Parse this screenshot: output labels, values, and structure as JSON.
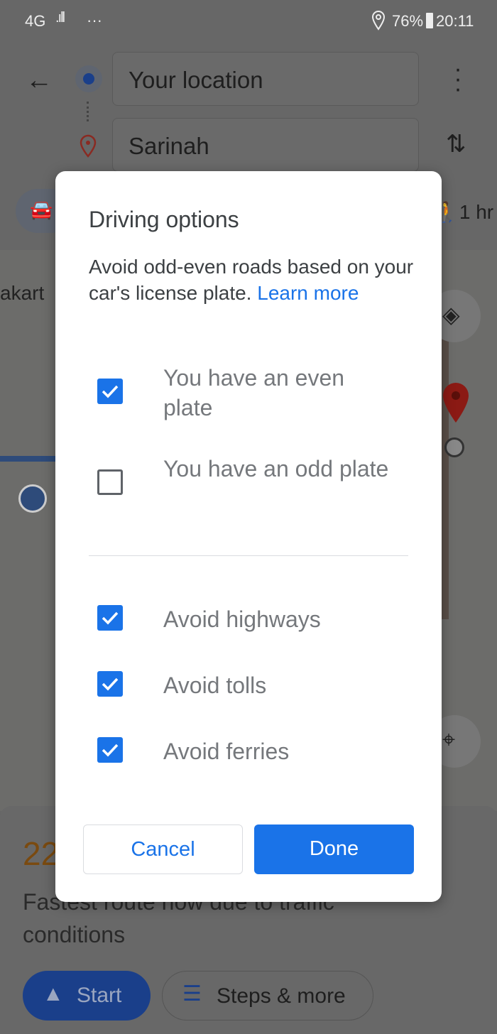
{
  "status_bar": {
    "network": "4G",
    "more": "···",
    "battery": "76%",
    "time": "20:11"
  },
  "header": {
    "origin": "Your location",
    "destination": "Sarinah",
    "walk_time": "1 hr"
  },
  "map": {
    "label": "akart"
  },
  "sheet": {
    "duration": "22",
    "note": "Fastest route now due to traffic conditions",
    "start_label": "Start",
    "steps_label": "Steps & more"
  },
  "dialog": {
    "title": "Driving options",
    "description": "Avoid odd-even roads based on your car's license plate.",
    "learn_more": "Learn more",
    "plate_options": [
      {
        "label": "You have an even plate",
        "checked": true
      },
      {
        "label": "You have an odd plate",
        "checked": false
      }
    ],
    "avoid_options": [
      {
        "label": "Avoid highways",
        "checked": true
      },
      {
        "label": "Avoid tolls",
        "checked": true
      },
      {
        "label": "Avoid ferries",
        "checked": true
      }
    ],
    "cancel_label": "Cancel",
    "done_label": "Done"
  },
  "colors": {
    "accent": "#1a73e8",
    "scrim": "#676767"
  }
}
